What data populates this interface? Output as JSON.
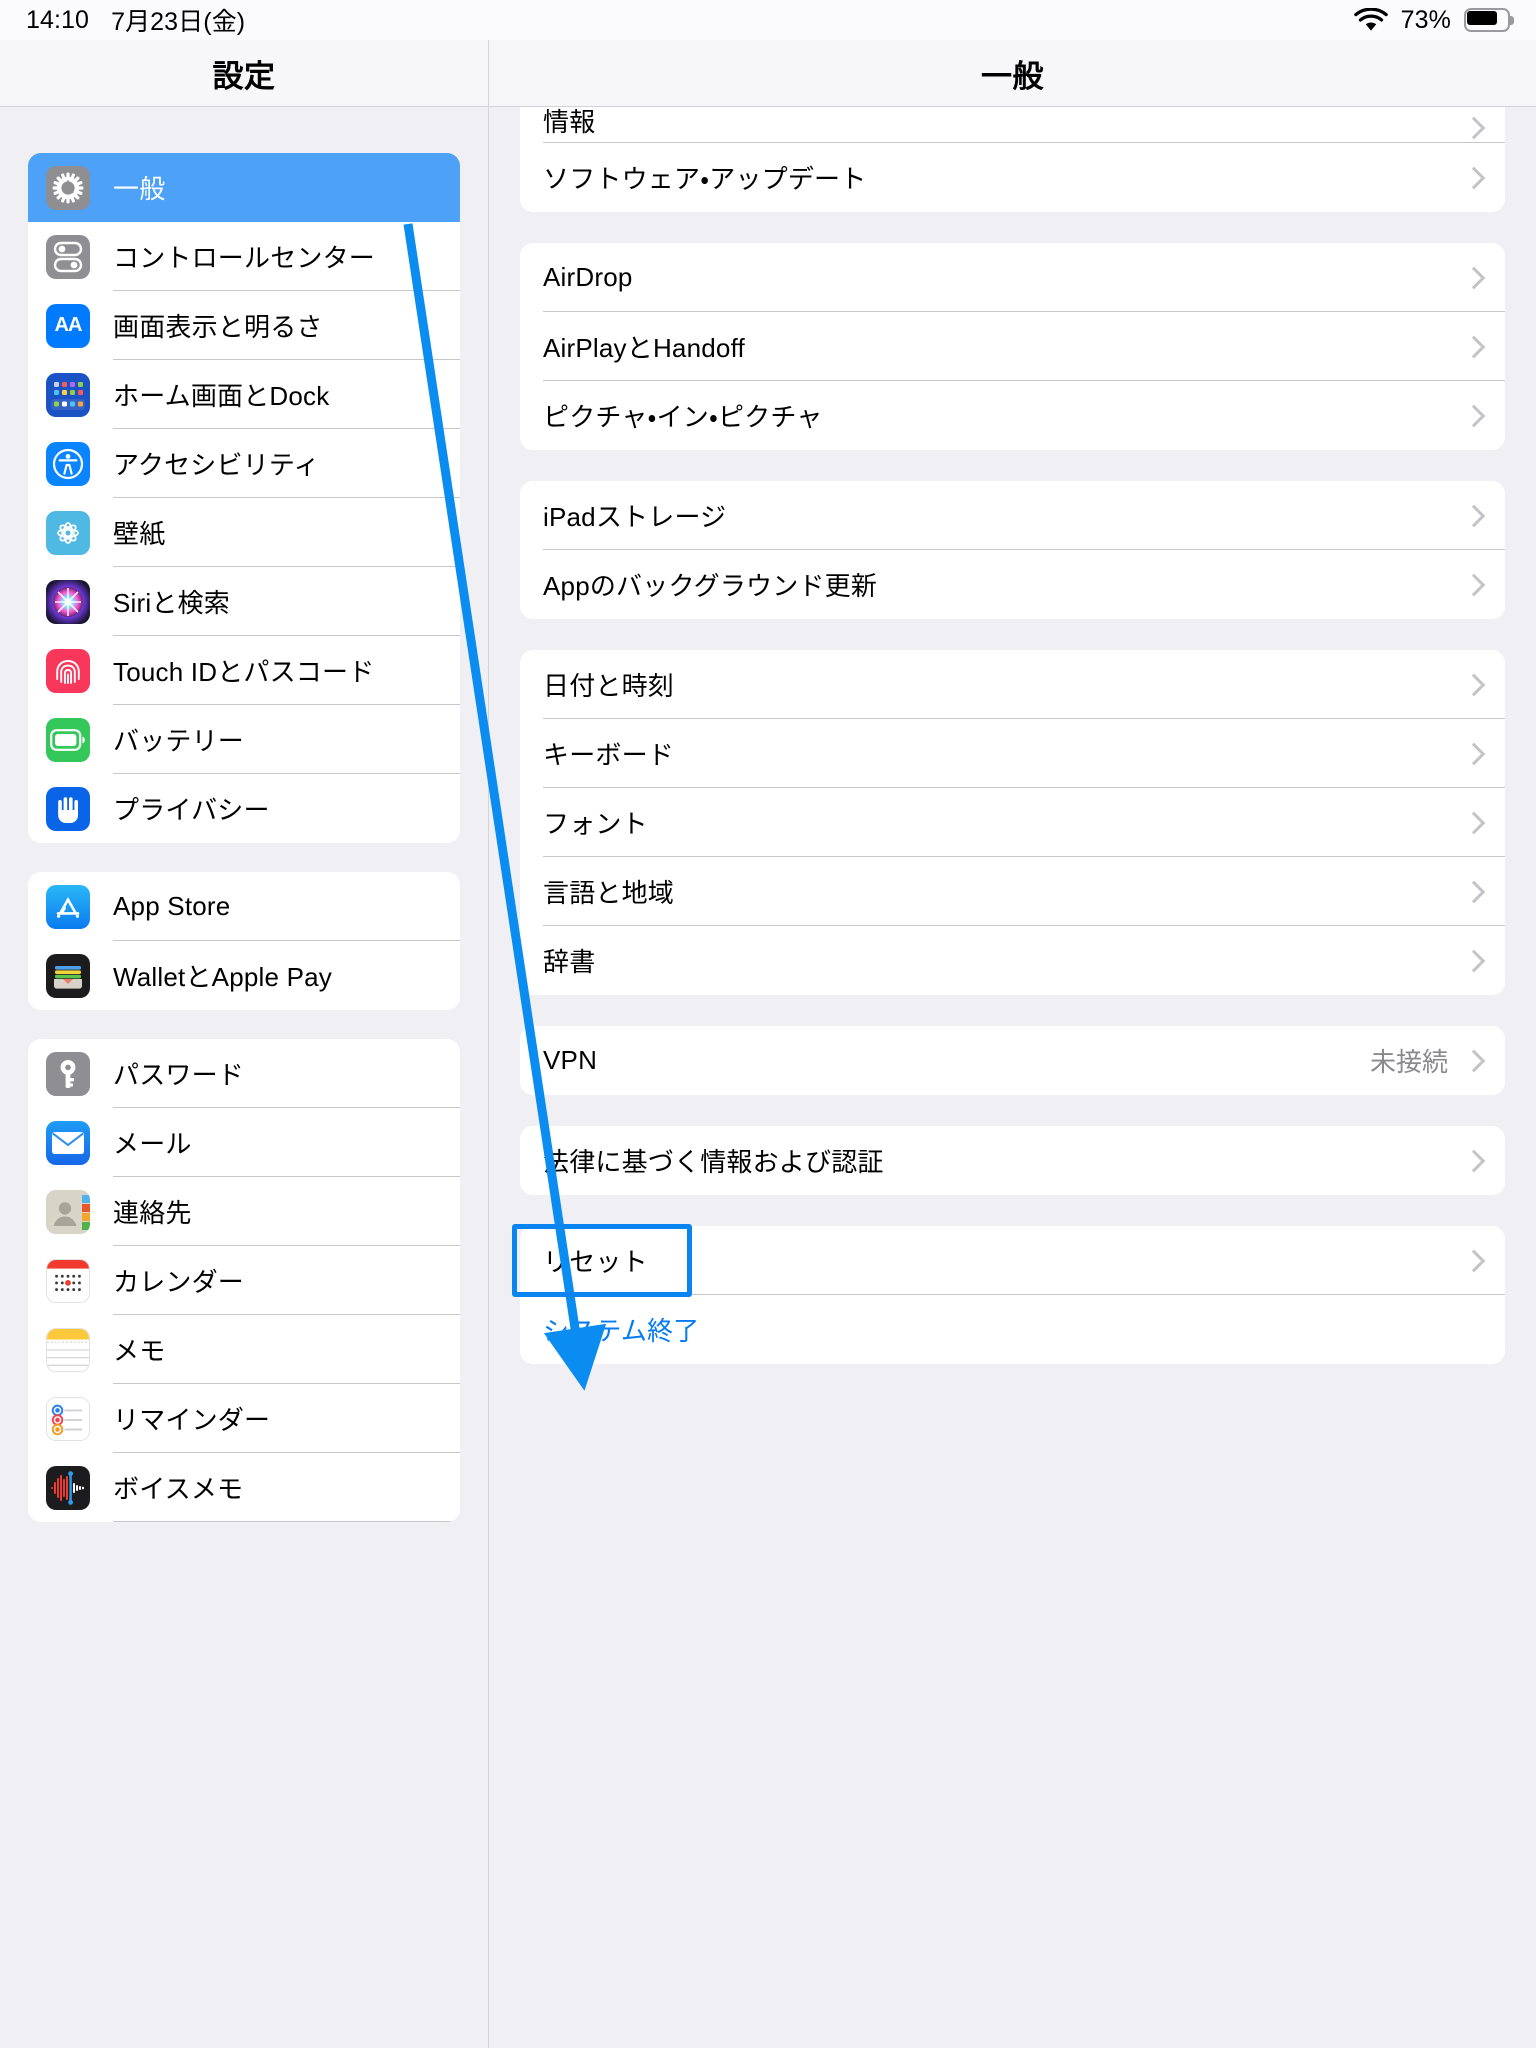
{
  "statusbar": {
    "time": "14:10",
    "date": "7月23日(金)",
    "wifi_icon": "wifi-icon",
    "battery_percent": "73%",
    "battery_icon": "battery-icon"
  },
  "sidebar": {
    "title": "設定",
    "groups": [
      {
        "items": [
          {
            "label": "一般",
            "icon": "gear-icon",
            "selected": true
          },
          {
            "label": "コントロールセンター",
            "icon": "control-center-icon",
            "selected": false
          },
          {
            "label": "画面表示と明るさ",
            "icon": "display-brightness-icon",
            "selected": false
          },
          {
            "label": "ホーム画面とDock",
            "icon": "home-screen-dock-icon",
            "selected": false
          },
          {
            "label": "アクセシビリティ",
            "icon": "accessibility-icon",
            "selected": false
          },
          {
            "label": "壁紙",
            "icon": "wallpaper-icon",
            "selected": false
          },
          {
            "label": "Siriと検索",
            "icon": "siri-icon",
            "selected": false
          },
          {
            "label": "Touch IDとパスコード",
            "icon": "touch-id-icon",
            "selected": false
          },
          {
            "label": "バッテリー",
            "icon": "battery-settings-icon",
            "selected": false
          },
          {
            "label": "プライバシー",
            "icon": "privacy-hand-icon",
            "selected": false
          }
        ]
      },
      {
        "items": [
          {
            "label": "App Store",
            "icon": "app-store-icon",
            "selected": false
          },
          {
            "label": "WalletとApple Pay",
            "icon": "wallet-icon",
            "selected": false
          }
        ]
      },
      {
        "items": [
          {
            "label": "パスワード",
            "icon": "passwords-key-icon",
            "selected": false
          },
          {
            "label": "メール",
            "icon": "mail-icon",
            "selected": false
          },
          {
            "label": "連絡先",
            "icon": "contacts-icon",
            "selected": false
          },
          {
            "label": "カレンダー",
            "icon": "calendar-icon",
            "selected": false
          },
          {
            "label": "メモ",
            "icon": "notes-icon",
            "selected": false
          },
          {
            "label": "リマインダー",
            "icon": "reminders-icon",
            "selected": false
          },
          {
            "label": "ボイスメモ",
            "icon": "voice-memos-icon",
            "selected": false
          }
        ]
      }
    ]
  },
  "detail": {
    "title": "一般",
    "groups": [
      {
        "clipped": true,
        "rows": [
          {
            "label": "情報",
            "value": "",
            "chevron": true,
            "link": false,
            "clipped": true
          },
          {
            "label": "ソフトウェア・アップデート",
            "value": "",
            "chevron": true,
            "link": false
          }
        ]
      },
      {
        "rows": [
          {
            "label": "AirDrop",
            "value": "",
            "chevron": true,
            "link": false
          },
          {
            "label": "AirPlayとHandoff",
            "value": "",
            "chevron": true,
            "link": false
          },
          {
            "label": "ピクチャ・イン・ピクチャ",
            "value": "",
            "chevron": true,
            "link": false
          }
        ]
      },
      {
        "rows": [
          {
            "label": "iPadストレージ",
            "value": "",
            "chevron": true,
            "link": false
          },
          {
            "label": "Appのバックグラウンド更新",
            "value": "",
            "chevron": true,
            "link": false
          }
        ]
      },
      {
        "rows": [
          {
            "label": "日付と時刻",
            "value": "",
            "chevron": true,
            "link": false
          },
          {
            "label": "キーボード",
            "value": "",
            "chevron": true,
            "link": false
          },
          {
            "label": "フォント",
            "value": "",
            "chevron": true,
            "link": false
          },
          {
            "label": "言語と地域",
            "value": "",
            "chevron": true,
            "link": false
          },
          {
            "label": "辞書",
            "value": "",
            "chevron": true,
            "link": false
          }
        ]
      },
      {
        "rows": [
          {
            "label": "VPN",
            "value": "未接続",
            "chevron": true,
            "link": false
          }
        ]
      },
      {
        "rows": [
          {
            "label": "法律に基づく情報および認証",
            "value": "",
            "chevron": true,
            "link": false
          }
        ]
      },
      {
        "rows": [
          {
            "label": "リセット",
            "value": "",
            "chevron": true,
            "link": false,
            "highlighted": true
          },
          {
            "label": "システム終了",
            "value": "",
            "chevron": false,
            "link": true
          }
        ]
      }
    ]
  },
  "annotation": {
    "arrow_color": "#0a8cf0",
    "highlight_color": "#0a84f0",
    "target_label": "リセット"
  }
}
